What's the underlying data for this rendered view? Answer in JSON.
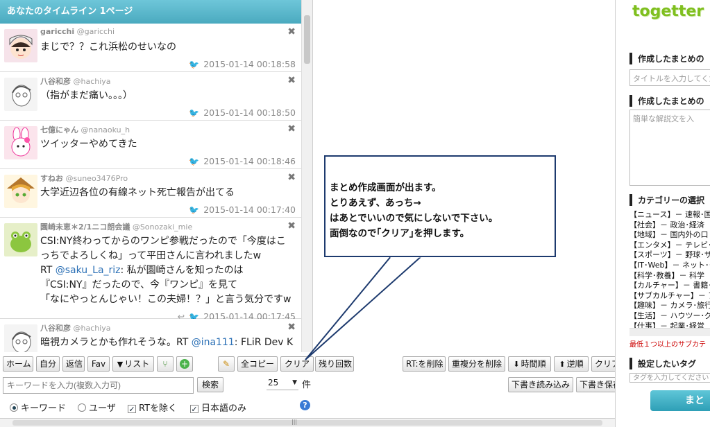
{
  "timeline": {
    "header": "あなたのタイムライン 1ページ",
    "tweets": [
      {
        "name": "garicchi",
        "handle": "@garicchi",
        "text": "まじで？？これ浜松のせいなの",
        "time": "2015-01-14 00:18:58",
        "avatar": "cartoon-cat-hood-avatar"
      },
      {
        "name": "八谷和彦",
        "handle": "@hachiya",
        "text": "（指がまだ痛い。。。）",
        "time": "2015-01-14 00:18:50",
        "avatar": "sketch-portrait-avatar"
      },
      {
        "name": "七億にゃん",
        "handle": "@nanaoku_h",
        "text": "ツイッターやめてきた",
        "time": "2015-01-14 00:18:46",
        "avatar": "pink-bunny-avatar"
      },
      {
        "name": "すねお",
        "handle": "@suneo3476Pro",
        "text": "大学近辺各位の有線ネット死亡報告が出てる",
        "time": "2015-01-14 00:17:40",
        "avatar": "anime-girl-avatar"
      },
      {
        "name": "園崎未恵＊2/1ニコ朗会議",
        "handle": "@Sonozaki_mie",
        "text_lines": [
          "CSI:NY終わってからのワンピ参戦だったので「今度はこ",
          "っちでよろしくね」って平田さんに言われましたw"
        ],
        "rt_prefix": "RT ",
        "rt_user": "@saku_La_riz",
        "rt_lines_first": ": 私が園崎さんを知ったのは",
        "rt_lines": [
          "『CSI:NY』だったので、今『ワンピ』を見て",
          "「なにやっとんじゃい！この夫婦！？」と言う気分ですw"
        ],
        "time": "2015-01-14 00:17:45",
        "avatar": "green-frog-avatar"
      },
      {
        "name": "八谷和彦",
        "handle": "@hachiya",
        "text_prefix": "暗視カメラとかも作れそうな。RT ",
        "text_user": "@ina111",
        "text_suffix": ": FLiR Dev K",
        "avatar": "sketch-portrait-avatar"
      }
    ]
  },
  "toolbar": {
    "row1": [
      "ホーム",
      "自分",
      "返信",
      "Fav",
      "リスト"
    ],
    "list_icon": "caret-down-icon",
    "copy_all": "全コピー",
    "clear_cut": "クリア",
    "remaining": "残り回数",
    "rt_remove": "RT:を削除",
    "dup_remove": "重複分を削除",
    "time_order": "時間順",
    "reverse_order": "逆順",
    "clear": "クリア",
    "draft_load": "下書き読み込み",
    "draft_save": "下書き保存",
    "search_placeholder": "キーワードを入力(複数入力可)",
    "search_button": "検索",
    "count_value": "25",
    "count_unit": "件",
    "options": {
      "keyword": "キーワード",
      "user": "ユーザ",
      "exclude_rt": "RTを除く",
      "japanese_only": "日本語のみ"
    }
  },
  "right_panel": {
    "logo": "togetter",
    "title_section": "作成したまとめの",
    "title_placeholder": "タイトルを入力してくだ",
    "desc_section": "作成したまとめの",
    "desc_placeholder": "簡単な解説文を入",
    "category_section": "カテゴリーの選択",
    "categories": [
      "【ニュース】－ 速報･国",
      "【社会】－ 政治･経済",
      "【地域】－ 国内外の口",
      "【エンタメ】－ テレビ･映",
      "【スポーツ】－ 野球･サ",
      "【IT･Web】－ ネット･モ",
      "【科学･教養】－ 科学",
      "【カルチャー】－ 書籍･",
      "【サブカルチャー】－ アニ",
      "【趣味】－ カメラ･旅行",
      "【生活】－ ハウツー･グ",
      "【仕事】－ 起業･経営"
    ],
    "category_warning": "最低１つ以上のサブカテ",
    "tag_section": "設定したいタグ",
    "tag_placeholder": "タグを入力してください",
    "create_button": "まと"
  },
  "callout": {
    "lines": [
      "まとめ作成画面が出ます。",
      "とりあえず、あっち→",
      "はあとでいいので気にしないで下さい。",
      "面倒なので｢クリア｣を押します。"
    ]
  }
}
